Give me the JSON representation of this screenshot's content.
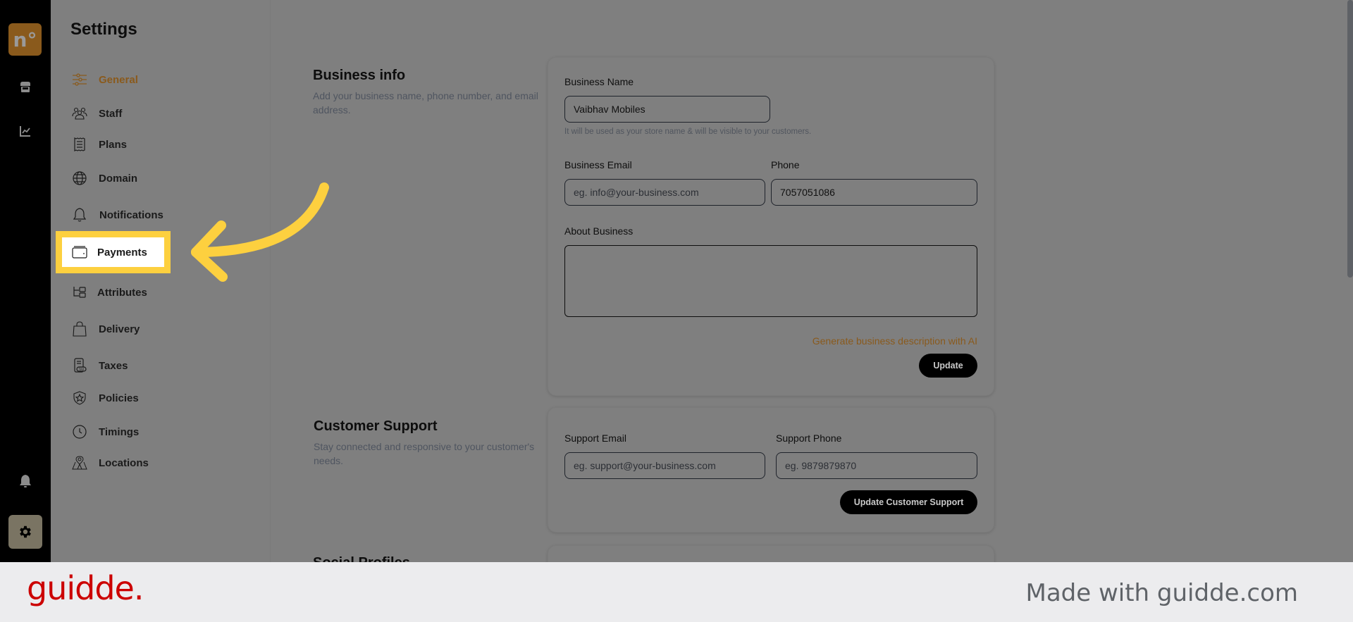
{
  "app": {
    "logo_text": "n°",
    "rail_icons": [
      "store-icon",
      "analytics-icon",
      "bell-icon",
      "gear-icon"
    ]
  },
  "settings": {
    "title": "Settings",
    "nav": [
      {
        "label": "General",
        "icon": "sliders-icon",
        "active": true
      },
      {
        "label": "Staff",
        "icon": "users-icon"
      },
      {
        "label": "Plans",
        "icon": "receipt-icon"
      },
      {
        "label": "Domain",
        "icon": "globe-icon"
      },
      {
        "label": "Notifications",
        "icon": "bell-icon"
      },
      {
        "label": "Payments",
        "icon": "wallet-icon",
        "highlighted": true
      },
      {
        "label": "Attributes",
        "icon": "hierarchy-icon"
      },
      {
        "label": "Delivery",
        "icon": "bag-icon"
      },
      {
        "label": "Taxes",
        "icon": "tax-receipt-icon"
      },
      {
        "label": "Policies",
        "icon": "shield-star-icon"
      },
      {
        "label": "Timings",
        "icon": "clock-icon"
      },
      {
        "label": "Locations",
        "icon": "map-pin-icon"
      }
    ]
  },
  "business_info": {
    "title": "Business info",
    "description": "Add your business name, phone number, and email address.",
    "name_label": "Business Name",
    "name_value": "Vaibhav Mobiles",
    "name_hint": "It will be used as your store name & will be visible to your customers.",
    "email_label": "Business Email",
    "email_placeholder": "eg. info@your-business.com",
    "phone_label": "Phone",
    "phone_value": "7057051086",
    "about_label": "About Business",
    "about_value": "",
    "ai_link": "Generate business description with AI",
    "update_button": "Update"
  },
  "customer_support": {
    "title": "Customer Support",
    "description": "Stay connected and responsive to your customer's needs.",
    "email_label": "Support Email",
    "email_placeholder": "eg. support@your-business.com",
    "phone_label": "Support Phone",
    "phone_placeholder": "eg. 9879879870",
    "update_button": "Update Customer Support"
  },
  "social_profiles": {
    "title": "Social Profiles"
  },
  "colors": {
    "accent": "#8a5a1c",
    "highlight": "#fdd03f",
    "overlay": "#7f7f7f"
  },
  "footer": {
    "brand": "guidde.",
    "made_with": "Made with guidde.com"
  }
}
